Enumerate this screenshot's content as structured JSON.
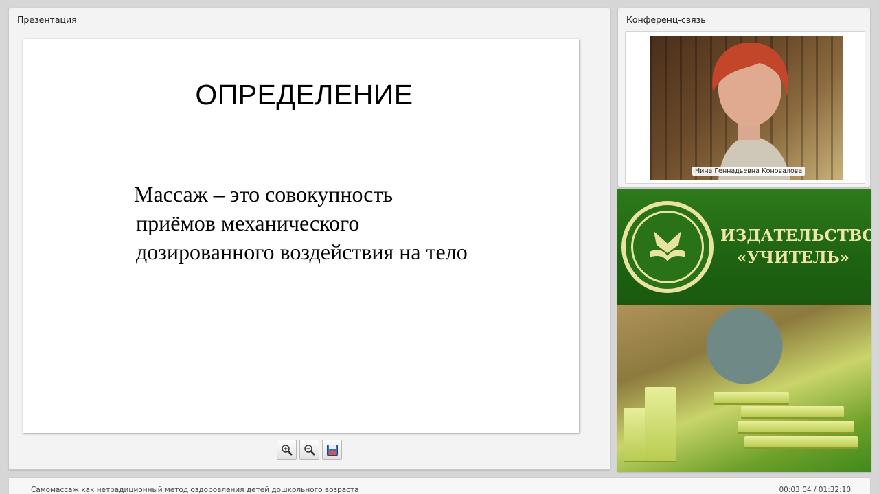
{
  "presentation": {
    "title": "Презентация",
    "slide": {
      "heading": "ОПРЕДЕЛЕНИЕ",
      "lines": [
        "Массаж – это совокупность",
        "приёмов механического",
        "дозированного воздействия на тело"
      ]
    },
    "toolbar": {
      "zoom_in_icon": "zoom-in-icon",
      "zoom_out_icon": "zoom-out-icon",
      "save_icon": "save-icon"
    }
  },
  "conference": {
    "title": "Конференц-связь",
    "participant_name": "Нина Геннадьевна Коновалова"
  },
  "ad": {
    "brand_line1": "ИЗДАТЕЛЬСТВО",
    "brand_line2": "«УЧИТЕЛЬ»",
    "colors": {
      "green": "#1e6312",
      "cream": "#eee6a8"
    }
  },
  "footer": {
    "title": "Самомассаж как нетрадиционный метод оздоровления детей дошкольного возраста",
    "time": "00:03:04 / 01:32:10"
  }
}
